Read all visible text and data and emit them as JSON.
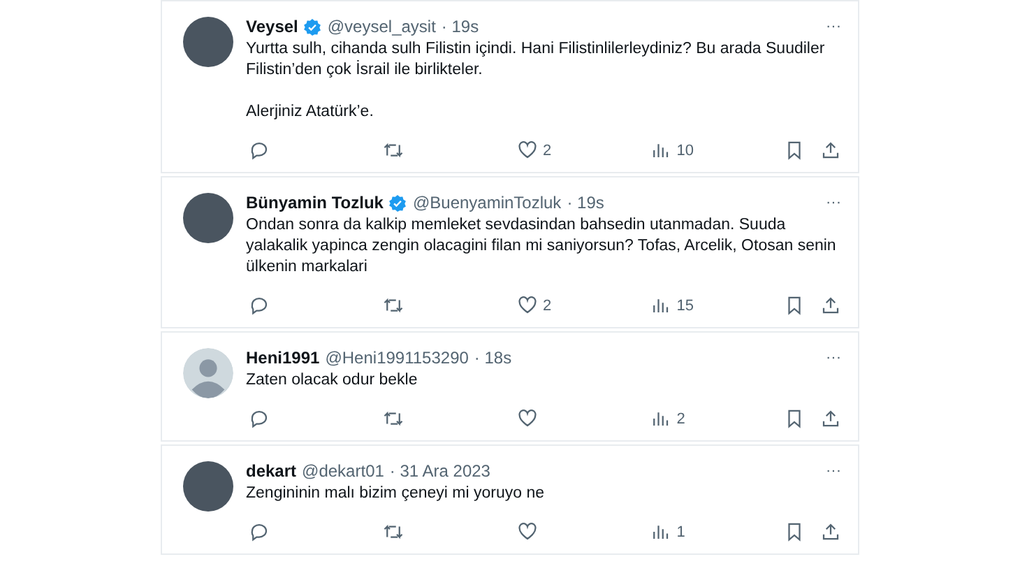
{
  "tweets": [
    {
      "name": "Veysel",
      "verified": true,
      "handle": "@veysel_aysit",
      "time": "· 19s",
      "default_avatar": false,
      "text": [
        "Yurtta sulh, cihanda sulh Filistin içindi. Hani Filistinlilerleydiniz? Bu arada Suudiler Filistin’den çok İsrail ile birlikteler.",
        "Alerjiniz Atatürk’e."
      ],
      "more": "···",
      "likes": "2",
      "views": "10"
    },
    {
      "name": "Bünyamin Tozluk",
      "verified": true,
      "handle": "@BuenyaminTozluk",
      "time": "· 19s",
      "default_avatar": false,
      "text": [
        "Ondan sonra da kalkip memleket sevdasindan bahsedin utanmadan. Suuda yalakalik yapinca zengin olacagini filan mi saniyorsun? Tofas, Arcelik, Otosan senin ülkenin markalari"
      ],
      "more": "···",
      "likes": "2",
      "views": "15"
    },
    {
      "name": "Heni1991",
      "verified": false,
      "handle": "@Heni1991153290",
      "time": "· 18s",
      "default_avatar": true,
      "text": [
        "Zaten olacak odur bekle"
      ],
      "more": "···",
      "views": "2"
    },
    {
      "name": "dekart",
      "verified": false,
      "handle": "@dekart01",
      "time": "· 31 Ara 2023",
      "default_avatar": false,
      "text": [
        "Zengininin malı bizim çeneyi mi yoruyo ne"
      ],
      "more": "···",
      "views": "1"
    }
  ]
}
